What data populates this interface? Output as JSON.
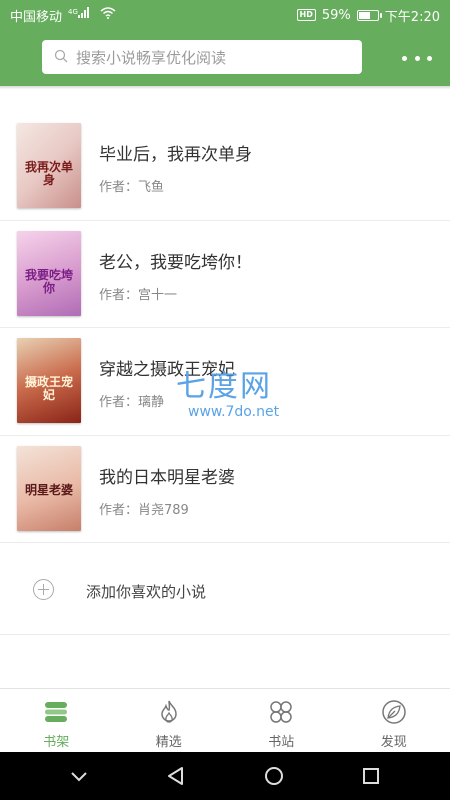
{
  "status": {
    "carrier": "中国移动",
    "signal": "4G",
    "battery": "59%",
    "battery_level": 0.59,
    "time": "下午2:20"
  },
  "search": {
    "placeholder": "搜索小说畅享优化阅读"
  },
  "books": [
    {
      "title": "毕业后，我再次单身",
      "author": "作者：飞鱼",
      "cover_text": "我再次单身"
    },
    {
      "title": "老公，我要吃垮你！",
      "author": "作者：宫十一",
      "cover_text": "我要吃垮你"
    },
    {
      "title": "穿越之摄政王宠妃",
      "author": "作者：璃静",
      "cover_text": "摄政王宠妃"
    },
    {
      "title": "我的日本明星老婆",
      "author": "作者：肖尧789",
      "cover_text": "明星老婆"
    }
  ],
  "add_book": {
    "label": "添加你喜欢的小说"
  },
  "watermark": {
    "title": "七度网",
    "url": "www.7do.net"
  },
  "tabs": [
    {
      "label": "书架",
      "icon": "bookshelf-icon",
      "active": true
    },
    {
      "label": "精选",
      "icon": "flame-icon",
      "active": false
    },
    {
      "label": "书站",
      "icon": "four-circles-icon",
      "active": false
    },
    {
      "label": "发现",
      "icon": "leaf-icon",
      "active": false
    }
  ],
  "colors": {
    "accent": "#66ad5d",
    "watermark": "#5aa3e6"
  }
}
